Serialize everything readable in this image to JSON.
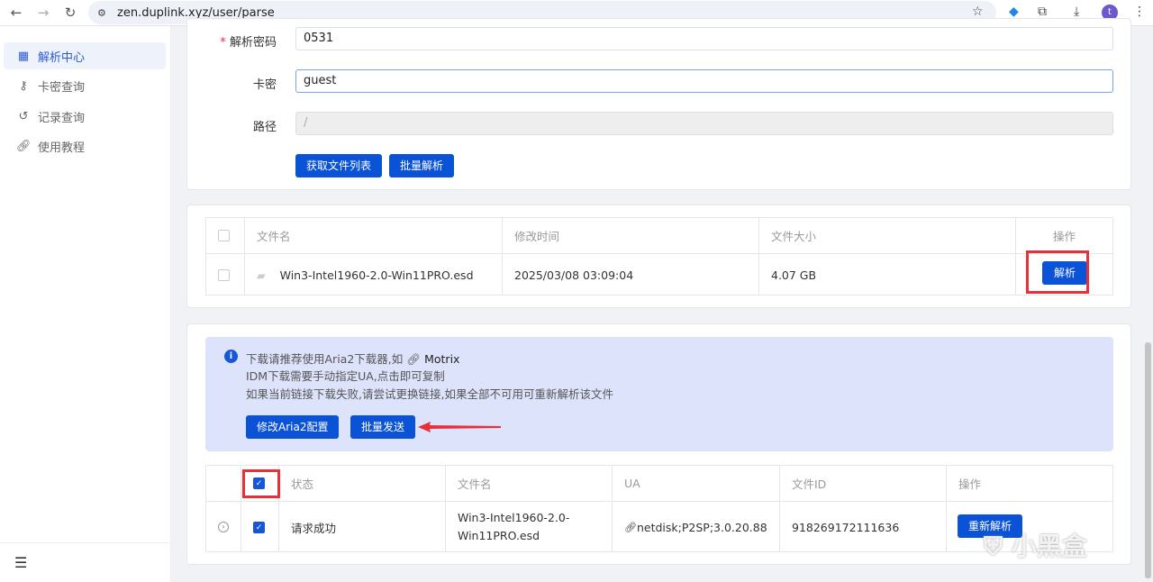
{
  "browser": {
    "url": "zen.duplink.xyz/user/parse",
    "avatar": "t"
  },
  "sidebar": {
    "items": [
      {
        "label": "解析中心",
        "icon": "grid-icon"
      },
      {
        "label": "卡密查询",
        "icon": "key-icon"
      },
      {
        "label": "记录查询",
        "icon": "history-icon"
      },
      {
        "label": "使用教程",
        "icon": "link-icon"
      }
    ],
    "menu_icon": "☰"
  },
  "form": {
    "password_label": "解析密码",
    "password_value": "0531",
    "card_label": "卡密",
    "card_value": "guest",
    "path_label": "路径",
    "path_value": "/",
    "get_list_button": "获取文件列表",
    "batch_parse_button": "批量解析",
    "required_mark": "*"
  },
  "files": {
    "columns": [
      "文件名",
      "修改时间",
      "文件大小",
      "操作"
    ],
    "rows": [
      {
        "name": "Win3-Intel1960-2.0-Win11PRO.esd",
        "modified": "2025/03/08 03:09:04",
        "size": "4.07 GB",
        "action": "解析"
      }
    ]
  },
  "alert": {
    "line1": "下载请推荐使用Aria2下载器,如",
    "link": "Motrix",
    "line2": "IDM下载需要手动指定UA,点击即可复制",
    "line3": "如果当前链接下载失败,请尝试更换链接,如果全部不可用可重新解析该文件",
    "aria_button": "修改Aria2配置",
    "batch_send_button": "批量发送"
  },
  "results": {
    "columns": [
      "状态",
      "文件名",
      "UA",
      "文件ID",
      "操作"
    ],
    "rows": [
      {
        "status": "请求成功",
        "name_line1": "Win3-Intel1960-2.0-",
        "name_line2": "Win11PRO.esd",
        "ua": "netdisk;P2SP;3.0.20.88",
        "file_id": "918269172111636",
        "action": "重新解析",
        "checked": true
      }
    ]
  },
  "watermark": "小黑盒",
  "colors": {
    "primary": "#0a52d6",
    "highlight": "#e8303a",
    "alert_bg": "#dde3fb"
  }
}
